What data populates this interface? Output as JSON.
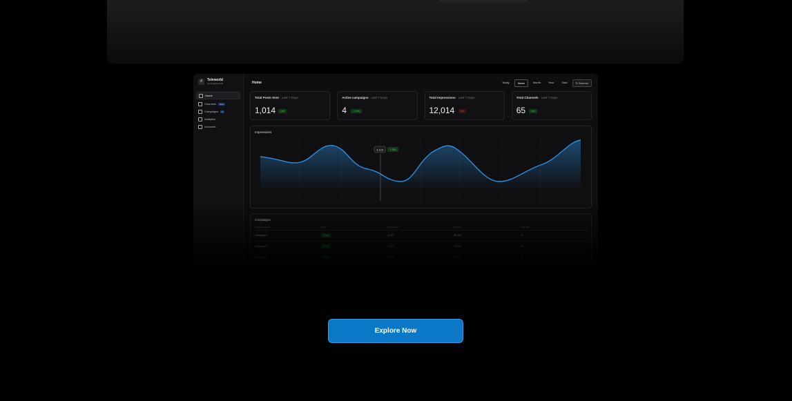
{
  "app": {
    "name": "Teleworld",
    "subtitle": "admin@teleworld"
  },
  "sidebar": {
    "items": [
      {
        "label": "Home",
        "icon": "home-icon",
        "active": true
      },
      {
        "label": "Channels",
        "icon": "send-icon",
        "badge": "New"
      },
      {
        "label": "Campaigns",
        "icon": "megaphone-icon",
        "badge": "3"
      },
      {
        "label": "Analytics",
        "icon": "chart-icon"
      },
      {
        "label": "Accounts",
        "icon": "users-icon"
      }
    ]
  },
  "header": {
    "title": "Home"
  },
  "range": {
    "options": [
      "Today",
      "Week",
      "Month",
      "Year",
      "Total"
    ],
    "selected": "Week",
    "refresh": "Refresh"
  },
  "stats": [
    {
      "label": "Total Posts Sent",
      "period": "· Last 7 Days",
      "value": "1,014",
      "delta": "+3%",
      "trend": "up"
    },
    {
      "label": "Active campaigns",
      "period": "· Last 7 Days",
      "value": "4",
      "delta": "+ 1.5%",
      "trend": "up"
    },
    {
      "label": "Total Impressions",
      "period": "· Last 7 Days",
      "value": "12,014",
      "delta": "-2%",
      "trend": "down"
    },
    {
      "label": "Total Channels",
      "period": "· Last 7 Days",
      "value": "65",
      "delta": "+2%",
      "trend": "up"
    }
  ],
  "impressions": {
    "title": "Impressions",
    "tooltip": {
      "value": "3,123",
      "delta": "+ 3%"
    }
  },
  "campaigns": {
    "title": "Campaigns",
    "columns": [
      "Campaign Name",
      "Status",
      "Impressions",
      "Budget",
      "Channels"
    ],
    "rows": [
      {
        "name": "Campaign 1",
        "status": "Active",
        "impressions": "3,213",
        "budget": "$1,000",
        "channels": "12"
      },
      {
        "name": "Campaign 2",
        "status": "Active",
        "impressions": "3,213",
        "budget": "$1,000",
        "channels": "15"
      },
      {
        "name": "Campaign 3",
        "status": "Active",
        "impressions": "3,213",
        "budget": "$1,000",
        "channels": "15"
      }
    ]
  },
  "cta": {
    "label": "Explore Now"
  },
  "colors": {
    "accent": "#0a78c6",
    "line": "#2d8fe0",
    "up": "#4ed35b",
    "down": "#e25b5b"
  }
}
